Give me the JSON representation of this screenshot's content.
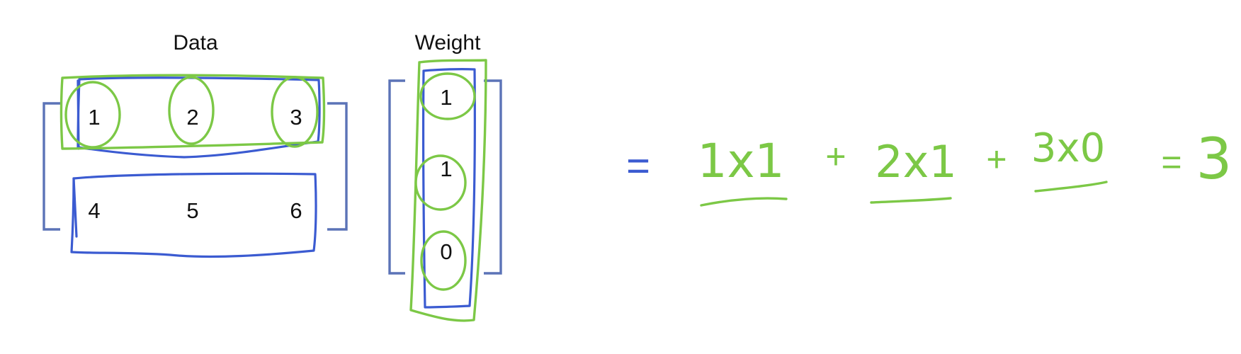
{
  "diagram": {
    "data_title": "Data",
    "weight_title": "Weight",
    "data_matrix": [
      [
        "1",
        "2",
        "3"
      ],
      [
        "4",
        "5",
        "6"
      ]
    ],
    "weight_vector": [
      "1",
      "1",
      "0"
    ],
    "equation": {
      "equals": "=",
      "terms": [
        "1x1",
        "2x1",
        "3x0"
      ],
      "plus": "+",
      "result": "3"
    },
    "colors": {
      "bracket": "#5b73b7",
      "ink_blue": "#3b5bd1",
      "ink_green": "#7cc846",
      "text": "#111111"
    }
  }
}
